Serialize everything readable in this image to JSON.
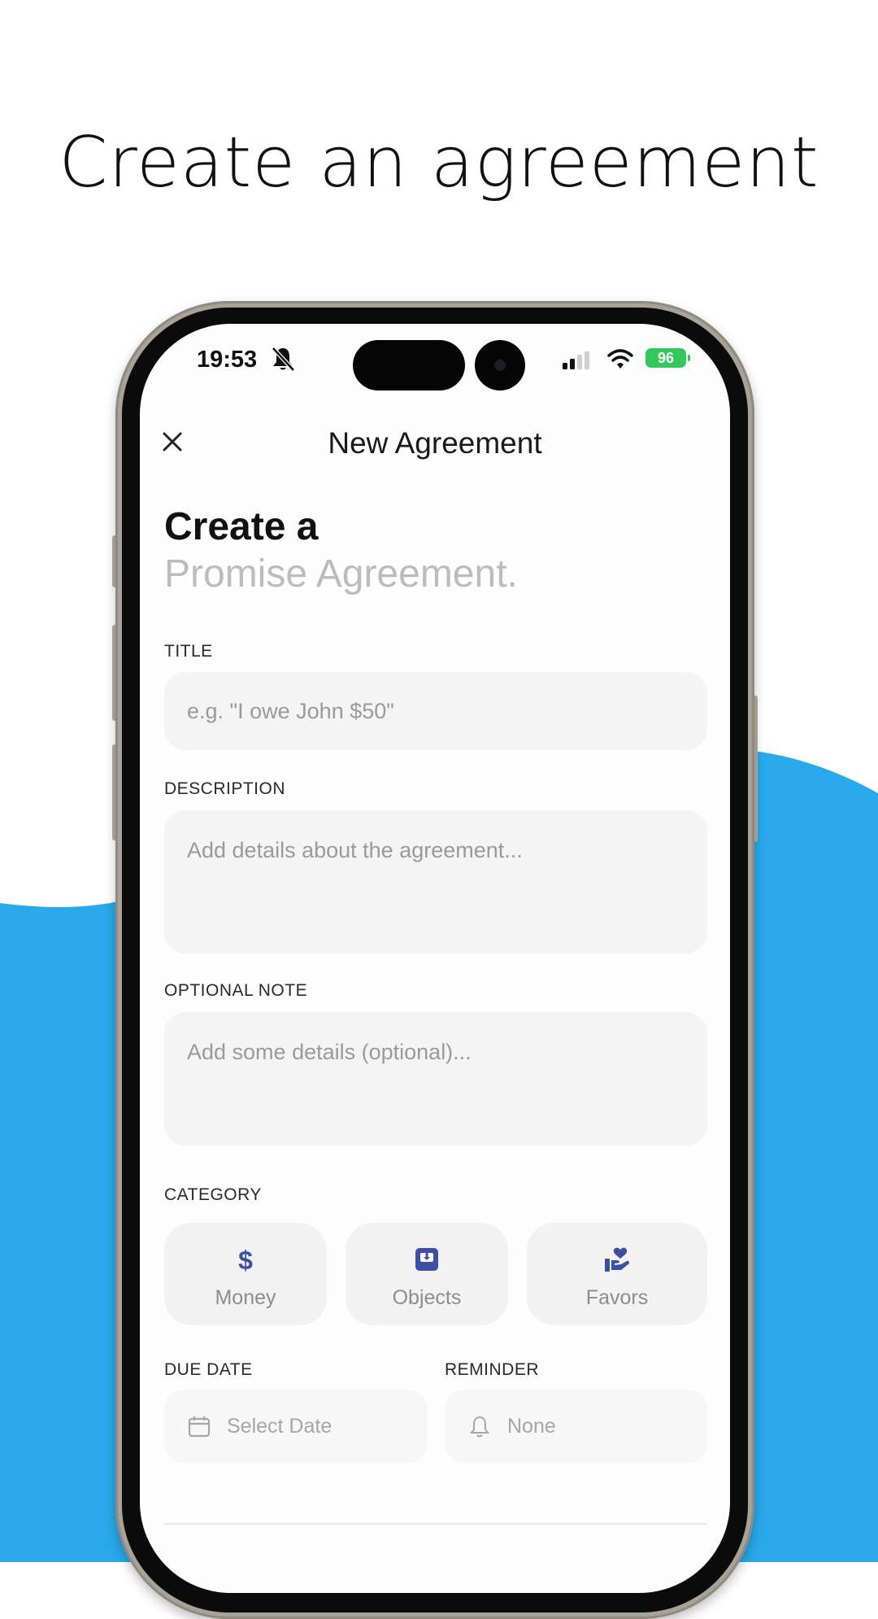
{
  "headline": "Create an agreement",
  "colors": {
    "accent_blue": "#29a9eb",
    "category_icon": "#3d4fa3",
    "battery_green": "#34c759"
  },
  "status_bar": {
    "time": "19:53",
    "battery": "96"
  },
  "nav": {
    "title": "New Agreement",
    "close_icon": "close-icon"
  },
  "hero": {
    "line1": "Create a",
    "line2": "Promise Agreement."
  },
  "form": {
    "title": {
      "label": "TITLE",
      "placeholder": "e.g. \"I owe John $50\""
    },
    "description": {
      "label": "DESCRIPTION",
      "placeholder": "Add details about the agreement..."
    },
    "optional_note": {
      "label": "OPTIONAL NOTE",
      "placeholder": "Add some details (optional)..."
    },
    "category": {
      "label": "CATEGORY",
      "options": [
        {
          "label": "Money",
          "icon": "dollar-icon"
        },
        {
          "label": "Objects",
          "icon": "box-icon"
        },
        {
          "label": "Favors",
          "icon": "heart-hand-icon"
        }
      ]
    },
    "due_date": {
      "label": "DUE DATE",
      "value": "Select Date",
      "icon": "calendar-icon"
    },
    "reminder": {
      "label": "REMINDER",
      "value": "None",
      "icon": "bell-icon"
    }
  }
}
